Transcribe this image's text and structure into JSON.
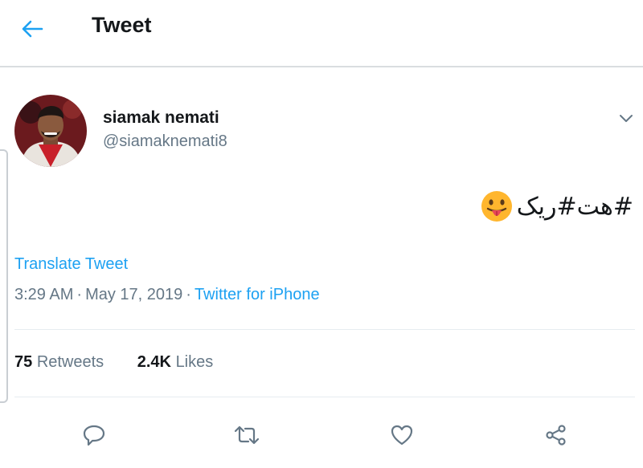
{
  "header": {
    "title": "Tweet"
  },
  "tweet": {
    "author_name": "siamak nemati",
    "author_handle": "@siamaknemati8",
    "text": "#هت#ریک",
    "translate_label": "Translate Tweet",
    "time": "3:29 AM",
    "separator": "·",
    "date": "May 17, 2019",
    "source": "Twitter for iPhone"
  },
  "stats": {
    "retweets_count": "75",
    "retweets_label": "Retweets",
    "likes_count": "2.4K",
    "likes_label": "Likes"
  },
  "colors": {
    "accent": "#1da1f2",
    "secondary_text": "#657786",
    "primary_text": "#14171a"
  },
  "icons": [
    "back-arrow-icon",
    "chevron-down-icon",
    "tongue-emoji-icon",
    "reply-icon",
    "retweet-icon",
    "like-icon",
    "share-icon"
  ]
}
